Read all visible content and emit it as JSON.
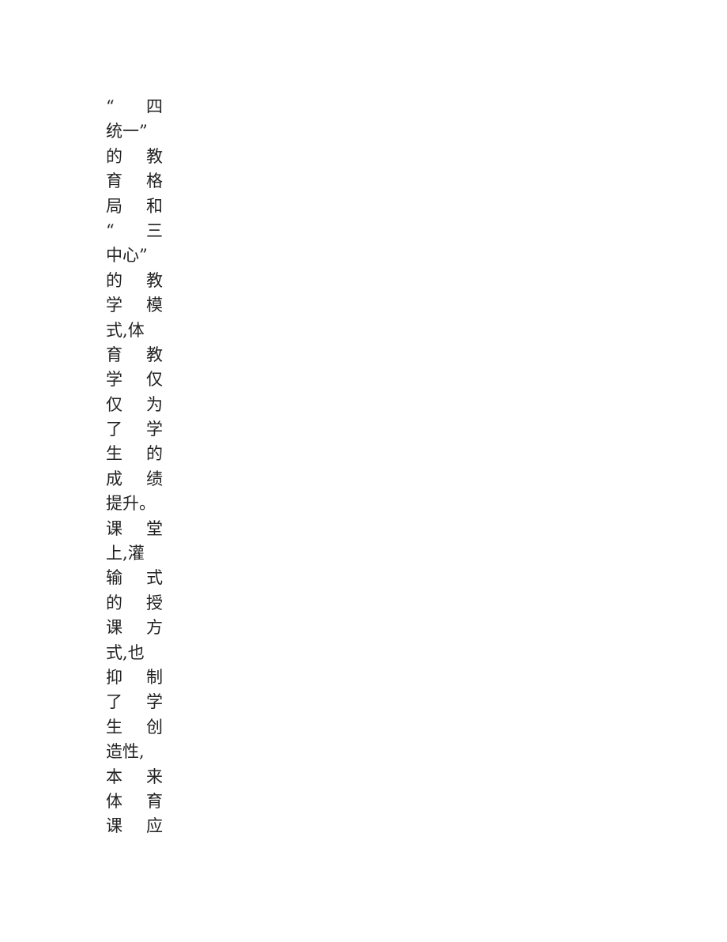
{
  "document": {
    "page_background": "#ffffff",
    "text_color": "#222222",
    "body_text": "“四统一”的教育格局和“三中心”的教学模式,体育教学仅仅为了学生的成绩提升。课堂上,灌输式的授课方式,也抑制了学生创造性,本来体育课应",
    "lines": [
      {
        "glyphs": [
          "“",
          "四"
        ]
      },
      {
        "glyphs": [
          "统",
          "一",
          "”"
        ]
      },
      {
        "glyphs": [
          "的",
          "教"
        ]
      },
      {
        "glyphs": [
          "育",
          "格"
        ]
      },
      {
        "glyphs": [
          "局",
          "和"
        ]
      },
      {
        "glyphs": [
          "“",
          "三"
        ]
      },
      {
        "glyphs": [
          "中",
          "心",
          "”"
        ]
      },
      {
        "glyphs": [
          "的",
          "教"
        ]
      },
      {
        "glyphs": [
          "学",
          "模"
        ]
      },
      {
        "glyphs": [
          "式",
          ",",
          "体"
        ]
      },
      {
        "glyphs": [
          "育",
          "教"
        ]
      },
      {
        "glyphs": [
          "学",
          "仅"
        ]
      },
      {
        "glyphs": [
          "仅",
          "为"
        ]
      },
      {
        "glyphs": [
          "了",
          "学"
        ]
      },
      {
        "glyphs": [
          "生",
          "的"
        ]
      },
      {
        "glyphs": [
          "成",
          "绩"
        ]
      },
      {
        "glyphs": [
          "提",
          "升",
          "。"
        ]
      },
      {
        "glyphs": [
          "课",
          "堂"
        ]
      },
      {
        "glyphs": [
          "上",
          ",",
          "灌"
        ]
      },
      {
        "glyphs": [
          "输",
          "式"
        ]
      },
      {
        "glyphs": [
          "的",
          "授"
        ]
      },
      {
        "glyphs": [
          "课",
          "方"
        ]
      },
      {
        "glyphs": [
          "式",
          ",",
          "也"
        ]
      },
      {
        "glyphs": [
          "抑",
          "制"
        ]
      },
      {
        "glyphs": [
          "了",
          "学"
        ]
      },
      {
        "glyphs": [
          "生",
          "创"
        ]
      },
      {
        "glyphs": [
          "造",
          "性",
          ","
        ]
      },
      {
        "glyphs": [
          "本",
          "来"
        ]
      },
      {
        "glyphs": [
          "体",
          "育"
        ]
      },
      {
        "glyphs": [
          "课",
          "应"
        ]
      }
    ]
  }
}
